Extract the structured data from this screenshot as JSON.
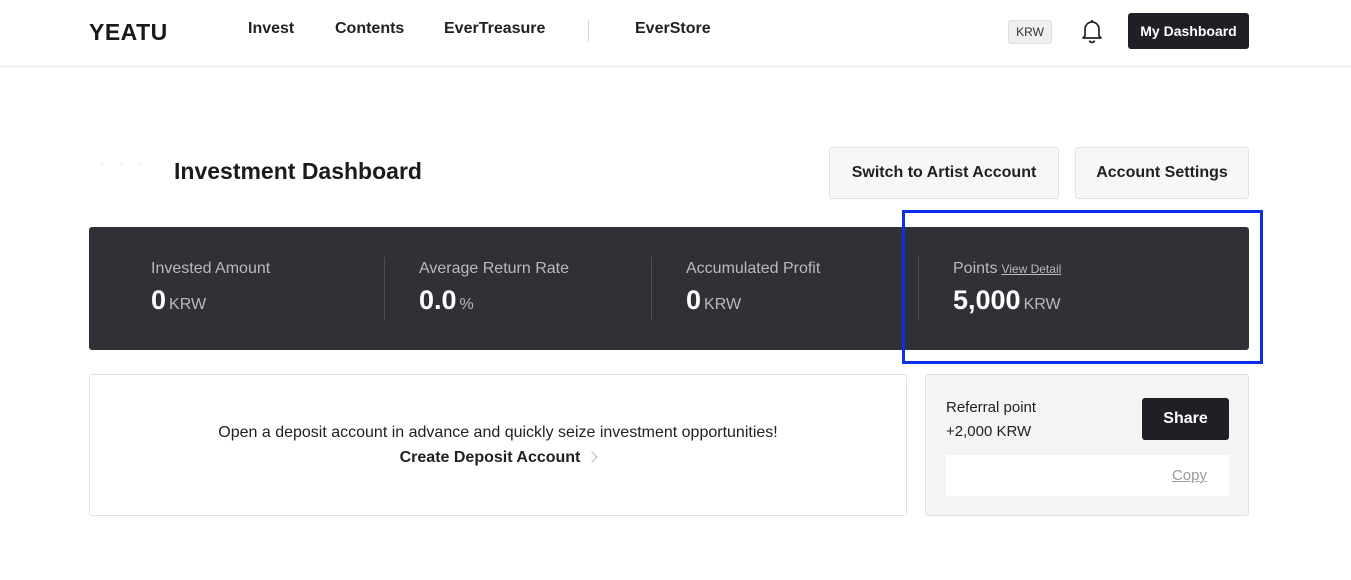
{
  "header": {
    "logo": "YEATU",
    "nav": [
      "Invest",
      "Contents",
      "EverTreasure",
      "EverStore"
    ],
    "currency": "KRW",
    "dashboard_button": "My Dashboard"
  },
  "page": {
    "title": "Investment Dashboard",
    "switch_button": "Switch to Artist Account",
    "settings_button": "Account Settings"
  },
  "stats": [
    {
      "label": "Invested Amount",
      "value": "0",
      "unit": "KRW"
    },
    {
      "label": "Average Return Rate",
      "value": "0.0",
      "unit": "%"
    },
    {
      "label": "Accumulated Profit",
      "value": "0",
      "unit": "KRW"
    },
    {
      "label": "Points",
      "value": "5,000",
      "unit": "KRW",
      "link": "View Detail"
    }
  ],
  "deposit": {
    "message": "Open a deposit account in advance and quickly seize investment opportunities!",
    "link": "Create Deposit Account"
  },
  "referral": {
    "title": "Referral point",
    "amount": "+2,000 KRW",
    "share_button": "Share",
    "copy_link": "Copy"
  },
  "colors": {
    "stats_panel": "#303036",
    "dark_button": "#1f2025",
    "highlight": "#0b2fe8"
  },
  "icons": [
    "bell-icon",
    "chevron-right-icon"
  ]
}
